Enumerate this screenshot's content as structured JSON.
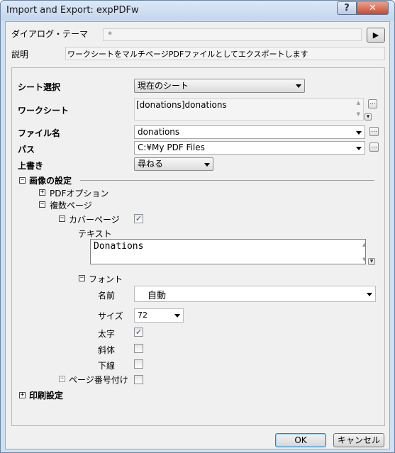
{
  "window": {
    "title": "Import and Export: expPDFw"
  },
  "titlebar": {
    "help_label": "?",
    "close_label": "✕"
  },
  "theme": {
    "label": "ダイアログ・テーマ",
    "value": "*",
    "arrow": "▶"
  },
  "description": {
    "label": "説明",
    "text": "ワークシートをマルチページPDFファイルとしてエクスポートします"
  },
  "form": {
    "sheet_select": {
      "label": "シート選択",
      "value": "現在のシート"
    },
    "worksheet": {
      "label": "ワークシート",
      "value": "[donations]donations"
    },
    "filename": {
      "label": "ファイル名",
      "value": "donations"
    },
    "path": {
      "label": "パス",
      "value": "C:¥My PDF Files"
    },
    "overwrite": {
      "label": "上書き",
      "value": "尋ねる"
    },
    "browse_label": "..."
  },
  "image_settings": {
    "label": "画像の設定",
    "pdf_options": {
      "label": "PDFオプション"
    },
    "multi_page": {
      "label": "複数ページ",
      "cover_page": {
        "label": "カバーページ",
        "checked": true,
        "text_label": "テキスト",
        "text_value": "Donations",
        "font": {
          "label": "フォント",
          "name": {
            "label": "名前",
            "value": "自動"
          },
          "size": {
            "label": "サイズ",
            "value": "72"
          },
          "bold": {
            "label": "太字",
            "checked": true
          },
          "italic": {
            "label": "斜体",
            "checked": false
          },
          "underline": {
            "label": "下線",
            "checked": false
          }
        }
      },
      "page_number": {
        "label": "ページ番号付け",
        "checked": false
      }
    }
  },
  "print_settings": {
    "label": "印刷設定"
  },
  "buttons": {
    "ok": "OK",
    "cancel": "キャンセル"
  },
  "icons": {
    "expand_collapsed": "+",
    "expand_open": "−",
    "check": "✓",
    "scroll_up": "▲",
    "scroll_down": "▼"
  }
}
